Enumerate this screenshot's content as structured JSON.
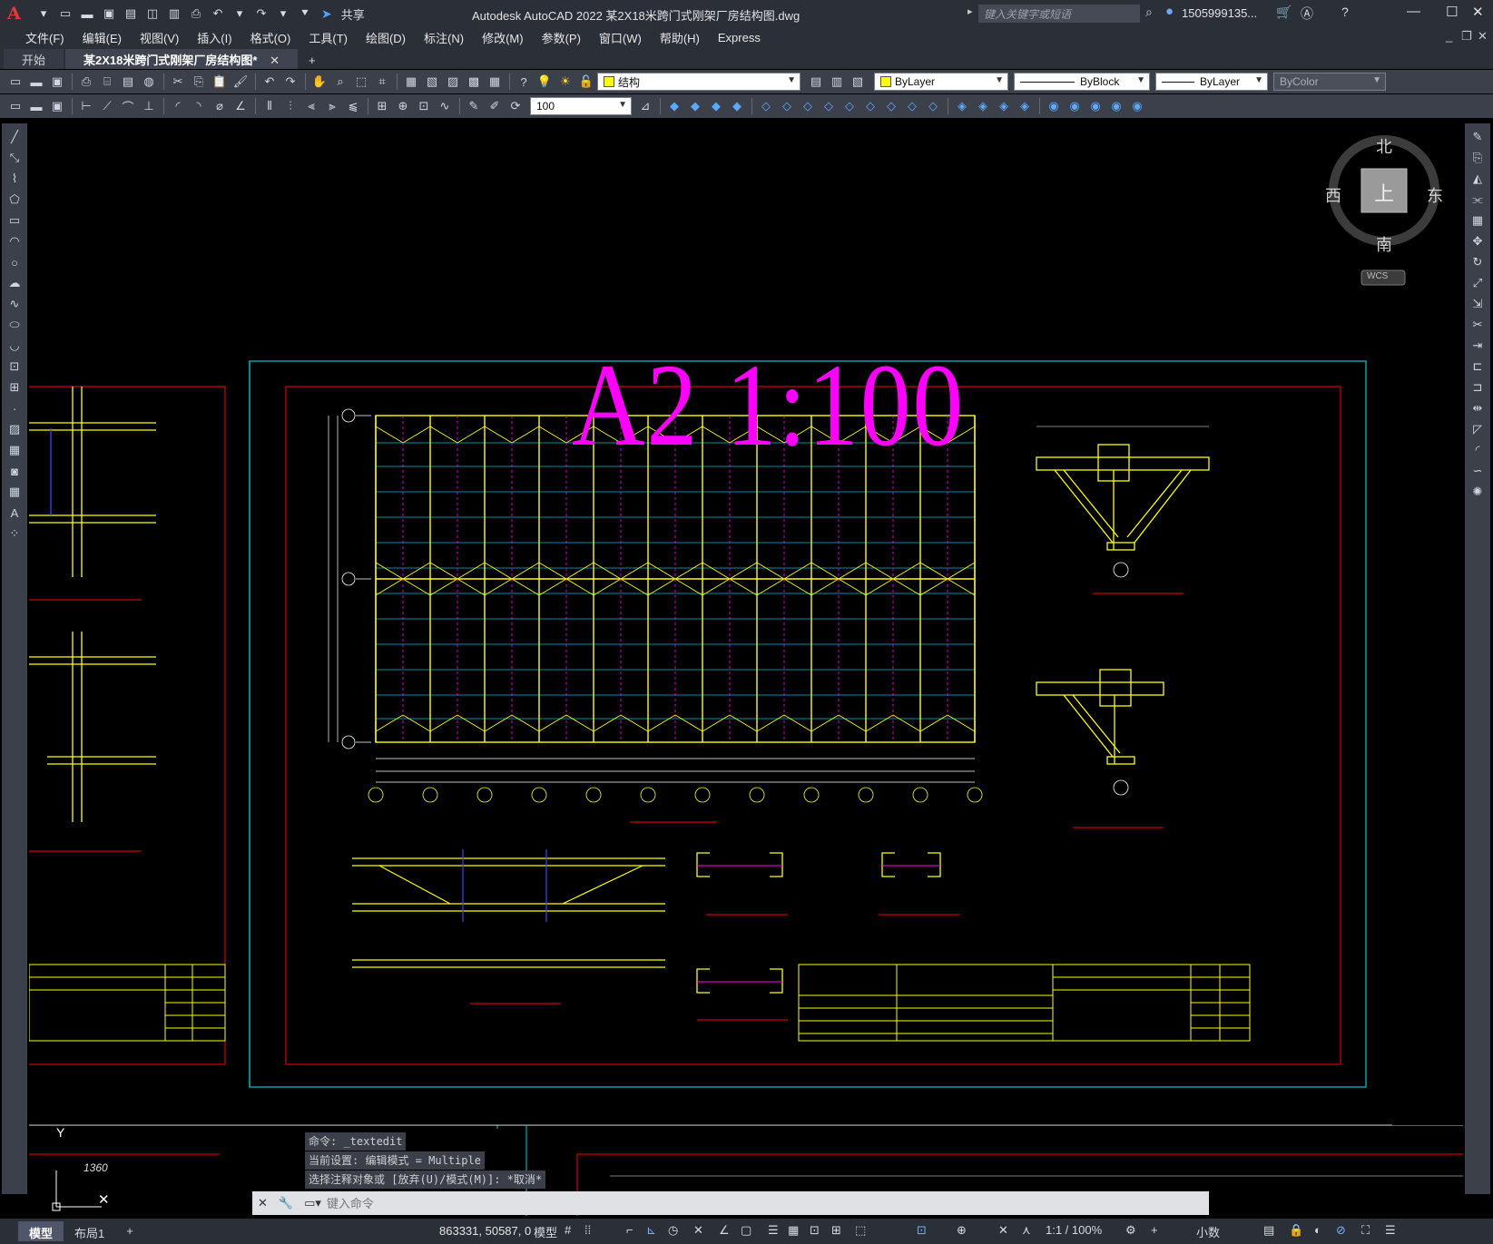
{
  "app": {
    "title": "Autodesk AutoCAD 2022    某2X18米跨门式刚架厂房结构图.dwg",
    "search_placeholder": "键入关键字或短语",
    "user": "1505999135...",
    "share": "共享"
  },
  "menu": [
    "文件(F)",
    "编辑(E)",
    "视图(V)",
    "插入(I)",
    "格式(O)",
    "工具(T)",
    "绘图(D)",
    "标注(N)",
    "修改(M)",
    "参数(P)",
    "窗口(W)",
    "帮助(H)",
    "Express"
  ],
  "tabs": {
    "start": "开始",
    "doc": "某2X18米跨门式刚架厂房结构图*",
    "close": "✕",
    "add": "+"
  },
  "toolbar": {
    "layer": "结构",
    "color": "ByLayer",
    "linetype": "ByBlock",
    "lineweight": "ByLayer",
    "plotstyle": "ByColor",
    "dimscale": "100"
  },
  "drawing": {
    "scale_label": "A2 1:100",
    "crosshair_len": "1360",
    "axis_y": "Y"
  },
  "viewcube": {
    "north": "北",
    "south": "南",
    "east": "东",
    "west": "西",
    "top": "上",
    "wcs": "WCS"
  },
  "command": {
    "history": [
      "命令: _textedit",
      "当前设置: 编辑模式 = Multiple",
      "选择注释对象或 [放弃(U)/模式(M)]: *取消*"
    ],
    "placeholder": "键入命令"
  },
  "status": {
    "layouts": [
      "模型",
      "布局1"
    ],
    "add_layout": "+",
    "coords": "863331, 50587, 0",
    "model": "模型",
    "annoscale": "1:1 / 100%",
    "units": "小数"
  },
  "colors": {
    "accent": "#ff00ff",
    "struct": "#ffff00",
    "frame": "#ff0000",
    "border": "#00cccc"
  }
}
